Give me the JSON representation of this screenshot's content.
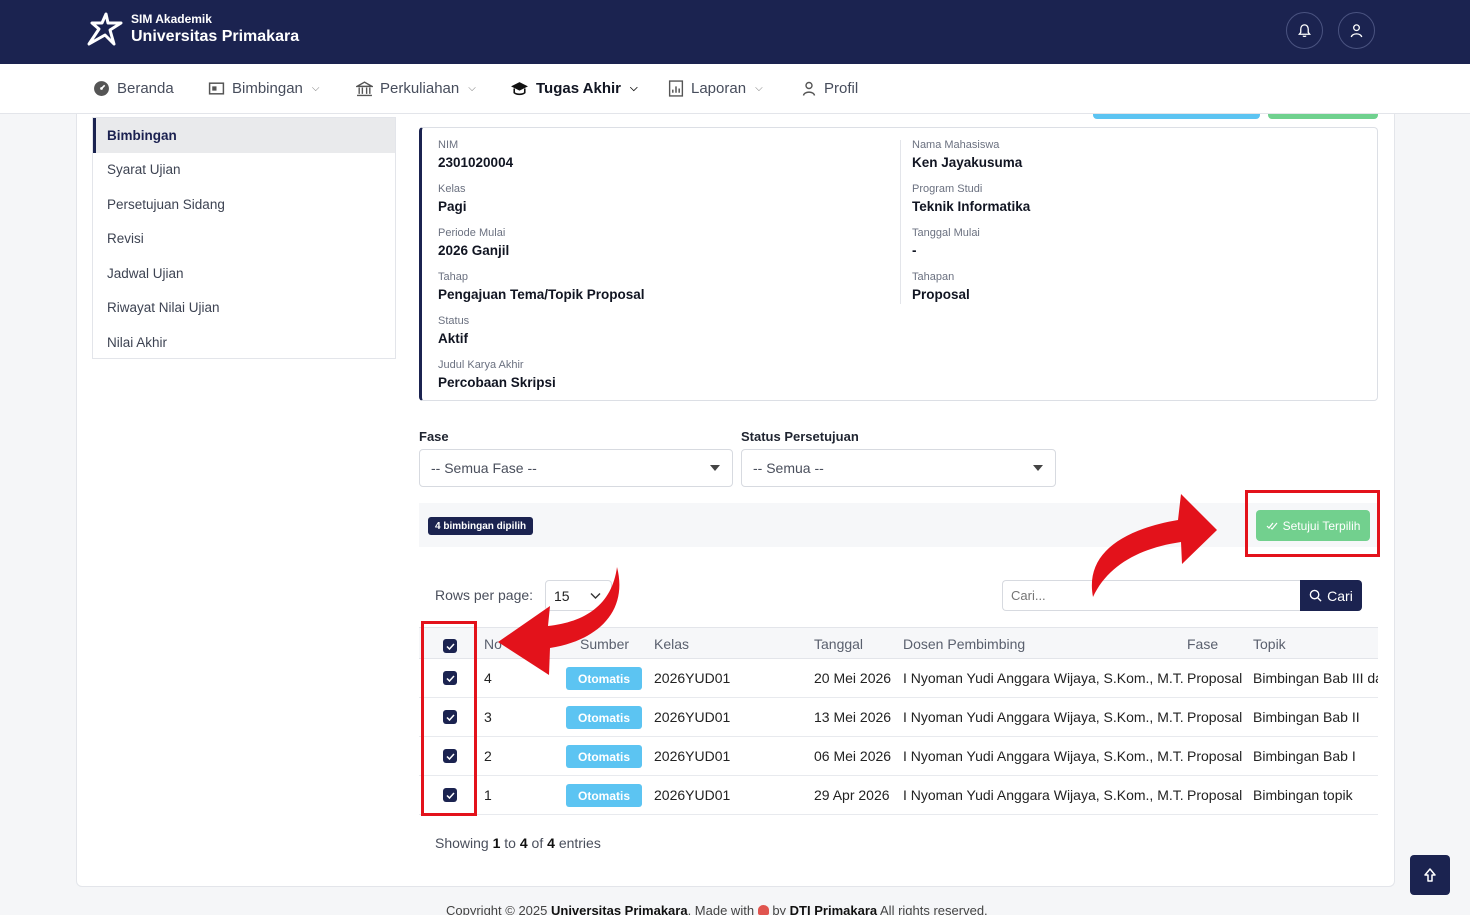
{
  "header": {
    "brand_sub": "SIM Akademik",
    "brand_title": "Universitas Primakara",
    "bg_color": "#1b2350"
  },
  "nav": {
    "items": [
      {
        "label": "Beranda",
        "icon": "dashboard-icon"
      },
      {
        "label": "Bimbingan",
        "icon": "presentation-icon"
      },
      {
        "label": "Perkuliahan",
        "icon": "bank-icon"
      },
      {
        "label": "Tugas Akhir",
        "icon": "graduation-cap-icon"
      },
      {
        "label": "Laporan",
        "icon": "report-icon"
      },
      {
        "label": "Profil",
        "icon": "user-icon"
      }
    ]
  },
  "sidebar": {
    "items": [
      {
        "label": "Bimbingan"
      },
      {
        "label": "Syarat Ujian"
      },
      {
        "label": "Persetujuan Sidang"
      },
      {
        "label": "Revisi"
      },
      {
        "label": "Jadwal Ujian"
      },
      {
        "label": "Riwayat Nilai Ujian"
      },
      {
        "label": "Nilai Akhir"
      }
    ]
  },
  "info": {
    "nim": {
      "label": "NIM",
      "value": "2301020004"
    },
    "kelas": {
      "label": "Kelas",
      "value": "Pagi"
    },
    "periode": {
      "label": "Periode Mulai",
      "value": "2026 Ganjil"
    },
    "tahap": {
      "label": "Tahap",
      "value": "Pengajuan Tema/Topik Proposal"
    },
    "status": {
      "label": "Status",
      "value": "Aktif"
    },
    "judul": {
      "label": "Judul Karya Akhir",
      "value": "Percobaan Skripsi"
    },
    "nama": {
      "label": "Nama Mahasiswa",
      "value": "Ken Jayakusuma"
    },
    "prodi": {
      "label": "Program Studi",
      "value": "Teknik Informatika"
    },
    "tanggal_mulai": {
      "label": "Tanggal Mulai",
      "value": "-"
    },
    "tahapan": {
      "label": "Tahapan",
      "value": "Proposal"
    }
  },
  "filters": {
    "fase": {
      "label": "Fase",
      "value": "-- Semua Fase --"
    },
    "status": {
      "label": "Status Persetujuan",
      "value": "-- Semua --"
    }
  },
  "selection": {
    "badge": "4 bimbingan dipilih",
    "approve_label": "Setujui Terpilih"
  },
  "table_controls": {
    "rows_label": "Rows per page:",
    "rows_value": "15",
    "search_placeholder": "Cari...",
    "search_button": "Cari"
  },
  "table": {
    "headers": [
      "No",
      "Sumber",
      "Kelas",
      "Tanggal",
      "Dosen Pembimbing",
      "Fase",
      "Topik"
    ],
    "rows": [
      {
        "no": "4",
        "sumber": "Otomatis",
        "kelas": "2026YUD01",
        "tanggal": "20 Mei 2026",
        "dosen": "I Nyoman Yudi Anggara Wijaya, S.Kom., M.T.",
        "fase": "Proposal",
        "topik": "Bimbingan Bab III dan IV",
        "checked": true
      },
      {
        "no": "3",
        "sumber": "Otomatis",
        "kelas": "2026YUD01",
        "tanggal": "13 Mei 2026",
        "dosen": "I Nyoman Yudi Anggara Wijaya, S.Kom., M.T.",
        "fase": "Proposal",
        "topik": "Bimbingan Bab II",
        "checked": true
      },
      {
        "no": "2",
        "sumber": "Otomatis",
        "kelas": "2026YUD01",
        "tanggal": "06 Mei 2026",
        "dosen": "I Nyoman Yudi Anggara Wijaya, S.Kom., M.T.",
        "fase": "Proposal",
        "topik": "Bimbingan Bab I",
        "checked": true
      },
      {
        "no": "1",
        "sumber": "Otomatis",
        "kelas": "2026YUD01",
        "tanggal": "29 Apr 2026",
        "dosen": "I Nyoman Yudi Anggara Wijaya, S.Kom., M.T.",
        "fase": "Proposal",
        "topik": "Bimbingan topik",
        "checked": true
      }
    ]
  },
  "showing": {
    "prefix": "Showing",
    "from": "1",
    "to_word": "to",
    "to": "4",
    "of_word": "of",
    "total": "4",
    "suffix": "entries"
  },
  "footer": {
    "prefix": "Copyright © 2025",
    "org": "Universitas Primakara",
    "made": ". Made with",
    "by": "by",
    "team": "DTI Primakara",
    "rights": "All rights reserved."
  },
  "colors": {
    "primary": "#1b2350",
    "info": "#5cc4f2",
    "success": "#72d08e",
    "annotation": "#e3121b"
  }
}
